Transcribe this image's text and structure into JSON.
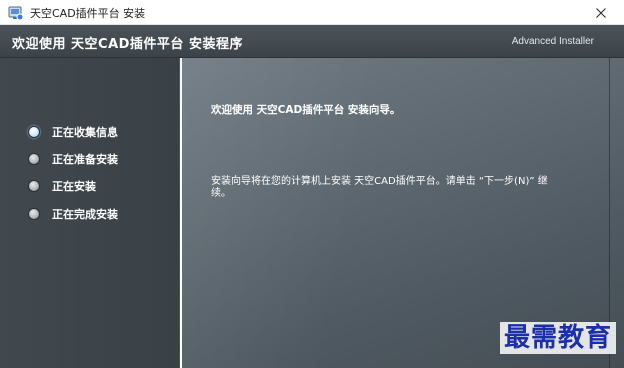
{
  "window": {
    "title": "天空CAD插件平台 安装",
    "close_icon": "close-icon"
  },
  "header": {
    "title": "欢迎使用 天空CAD插件平台 安装程序",
    "brand": "Advanced Installer"
  },
  "steps": [
    {
      "label": "正在收集信息",
      "active": true
    },
    {
      "label": "正在准备安装",
      "active": false
    },
    {
      "label": "正在安装",
      "active": false
    },
    {
      "label": "正在完成安装",
      "active": false
    }
  ],
  "main": {
    "heading": "欢迎使用 天空CAD插件平台 安装向导。",
    "body": "安装向导将在您的计算机上安装 天空CAD插件平台。请单击 “下一步(N)” 继续。"
  },
  "watermark": {
    "text": "最需教育"
  },
  "colors": {
    "accent_active_dot": "#8fc6ea",
    "header_bg": "#434a50",
    "watermark": "#1b2fa8"
  }
}
